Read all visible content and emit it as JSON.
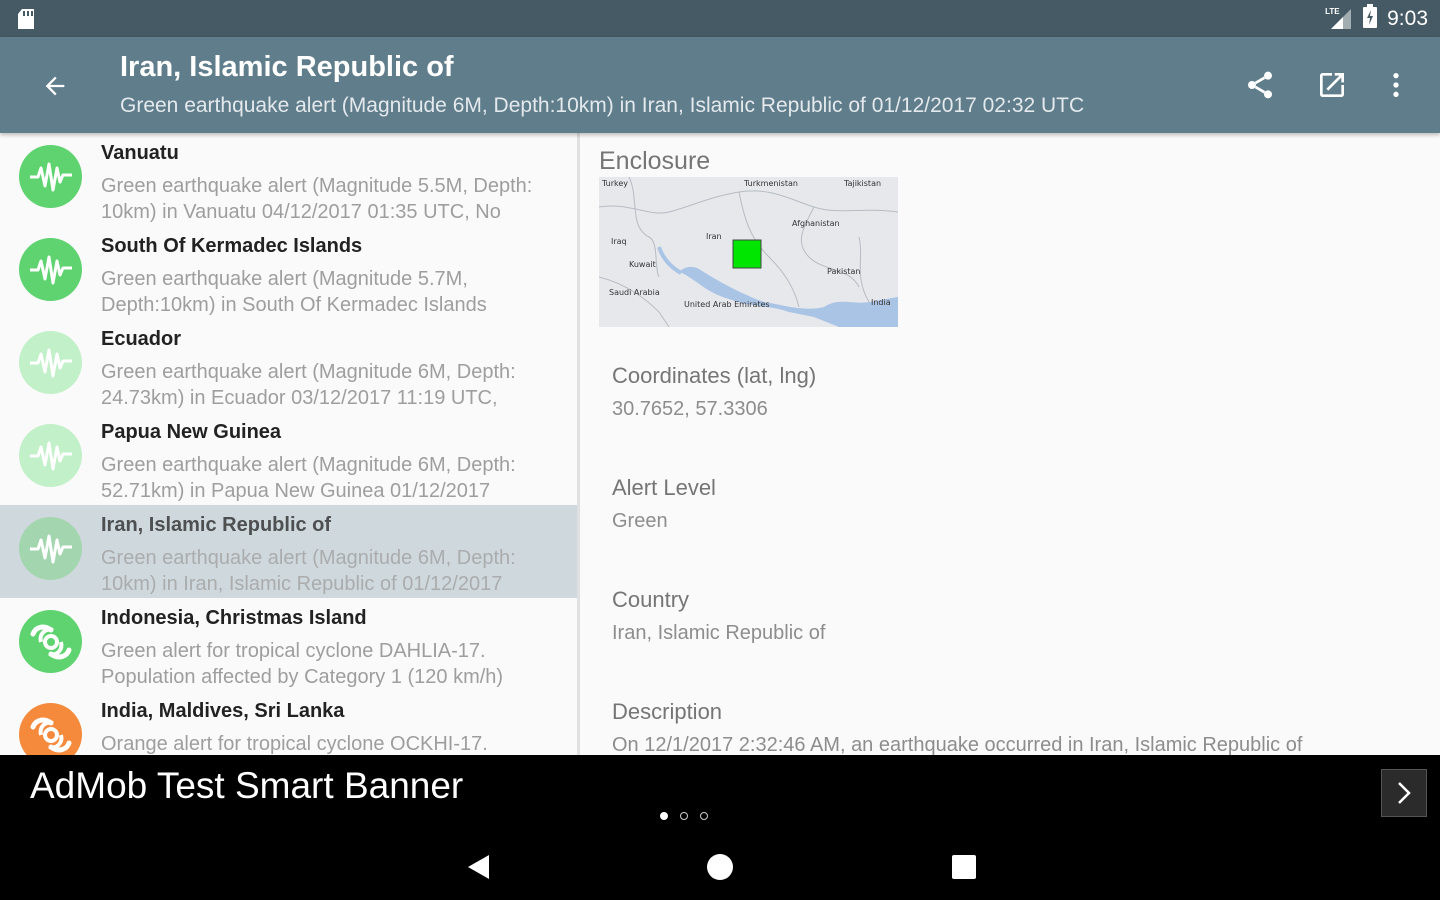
{
  "status_bar": {
    "time": "9:03",
    "network_label": "LTE"
  },
  "toolbar": {
    "title": "Iran, Islamic Republic of",
    "subtitle": "Green earthquake alert (Magnitude 6M, Depth:10km) in Iran, Islamic Republic of 01/12/2017 02:32 UTC"
  },
  "list": {
    "items": [
      {
        "title": "Vanuatu",
        "desc": "Green earthquake alert (Magnitude 5.5M, Depth: 10km) in Vanuatu 04/12/2017 01:35 UTC, No",
        "type": "earthquake",
        "color": "#5ed36f",
        "faded": false,
        "selected": false
      },
      {
        "title": "South Of Kermadec Islands",
        "desc": "Green earthquake alert (Magnitude 5.7M, Depth:10km) in South Of Kermadec Islands",
        "type": "earthquake",
        "color": "#5ed36f",
        "faded": false,
        "selected": false
      },
      {
        "title": "Ecuador",
        "desc": "Green earthquake alert (Magnitude 6M, Depth: 24.73km) in Ecuador 03/12/2017 11:19 UTC,",
        "type": "earthquake",
        "color": "#c2f0c8",
        "faded": true,
        "selected": false
      },
      {
        "title": "Papua New Guinea",
        "desc": "Green earthquake alert (Magnitude 6M, Depth: 52.71km) in Papua New Guinea 01/12/2017",
        "type": "earthquake",
        "color": "#c2f0c8",
        "faded": true,
        "selected": false
      },
      {
        "title": "Iran, Islamic Republic of",
        "desc": "Green earthquake alert (Magnitude 6M, Depth: 10km) in Iran, Islamic Republic of 01/12/2017",
        "type": "earthquake",
        "color": "#a3d6ae",
        "faded": true,
        "selected": true
      },
      {
        "title": "Indonesia, Christmas Island",
        "desc": "Green alert for tropical cyclone DAHLIA-17. Population affected by Category 1 (120 km/h)",
        "type": "cyclone",
        "color": "#5ed36f",
        "faded": false,
        "selected": false
      },
      {
        "title": "India, Maldives, Sri Lanka",
        "desc": "Orange alert for tropical cyclone OCKHI-17.",
        "type": "cyclone",
        "color": "#f58a3c",
        "faded": false,
        "selected": false
      }
    ]
  },
  "detail": {
    "enclosure_label": "Enclosure",
    "map_labels": {
      "turkey": "Turkey",
      "turkmenistan": "Turkmenistan",
      "tajikistan": "Tajikistan",
      "afghanistan": "Afghanistan",
      "iraq": "Iraq",
      "iran": "Iran",
      "kuwait": "Kuwait",
      "pakistan": "Pakistan",
      "saudi_arabia": "Saudi Arabia",
      "uae": "United Arab Emirates",
      "india": "India"
    },
    "marker_color": "#00e600",
    "fields": [
      {
        "label": "Coordinates (lat, lng)",
        "value": "30.7652, 57.3306"
      },
      {
        "label": "Alert Level",
        "value": "Green"
      },
      {
        "label": "Country",
        "value": "Iran, Islamic Republic of"
      },
      {
        "label": "Description",
        "value": "On 12/1/2017 2:32:46 AM, an earthquake occurred in Iran, Islamic Republic of"
      }
    ]
  },
  "ad": {
    "text": "AdMob Test Smart Banner"
  }
}
